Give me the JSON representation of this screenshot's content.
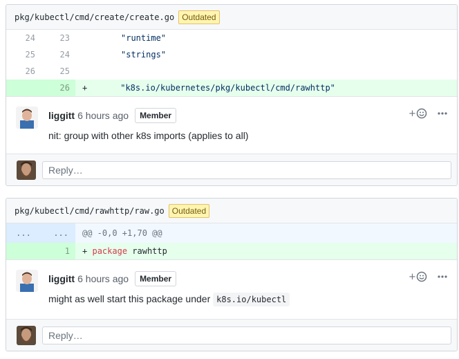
{
  "threads": [
    {
      "file_path": "pkg/kubectl/cmd/create/create.go",
      "outdated_label": "Outdated",
      "lines": [
        {
          "old": "24",
          "new": "23",
          "marker": "",
          "code": "\"runtime\""
        },
        {
          "old": "25",
          "new": "24",
          "marker": "",
          "code": "\"strings\""
        },
        {
          "old": "26",
          "new": "25",
          "marker": "",
          "code": ""
        },
        {
          "old": "",
          "new": "26",
          "marker": "+",
          "code": "\"k8s.io/kubernetes/pkg/kubectl/cmd/rawhttp\""
        }
      ],
      "comment": {
        "author": "liggitt",
        "time": "6 hours ago",
        "role": "Member",
        "text": "nit: group with other k8s imports (applies to all)"
      },
      "reply_placeholder": "Reply…"
    },
    {
      "file_path": "pkg/kubectl/cmd/rawhttp/raw.go",
      "outdated_label": "Outdated",
      "hunk": {
        "old": "...",
        "new": "...",
        "text": "@@ -0,0 +1,70 @@"
      },
      "add_line": {
        "new": "1",
        "marker": "+",
        "keyword": "package",
        "rest": "rawhttp"
      },
      "comment": {
        "author": "liggitt",
        "time": "6 hours ago",
        "role": "Member",
        "text": "might as well start this package under",
        "code": "k8s.io/kubectl"
      },
      "reply_placeholder": "Reply…"
    }
  ],
  "icons": {
    "reaction": "smiley-add-icon",
    "more": "kebab-horizontal-icon"
  },
  "colors": {
    "outdated_bg": "#fff5b1",
    "add_bg": "#e6ffed",
    "hunk_bg": "#f1f8ff",
    "string": "#032f62",
    "keyword": "#d73a49"
  }
}
